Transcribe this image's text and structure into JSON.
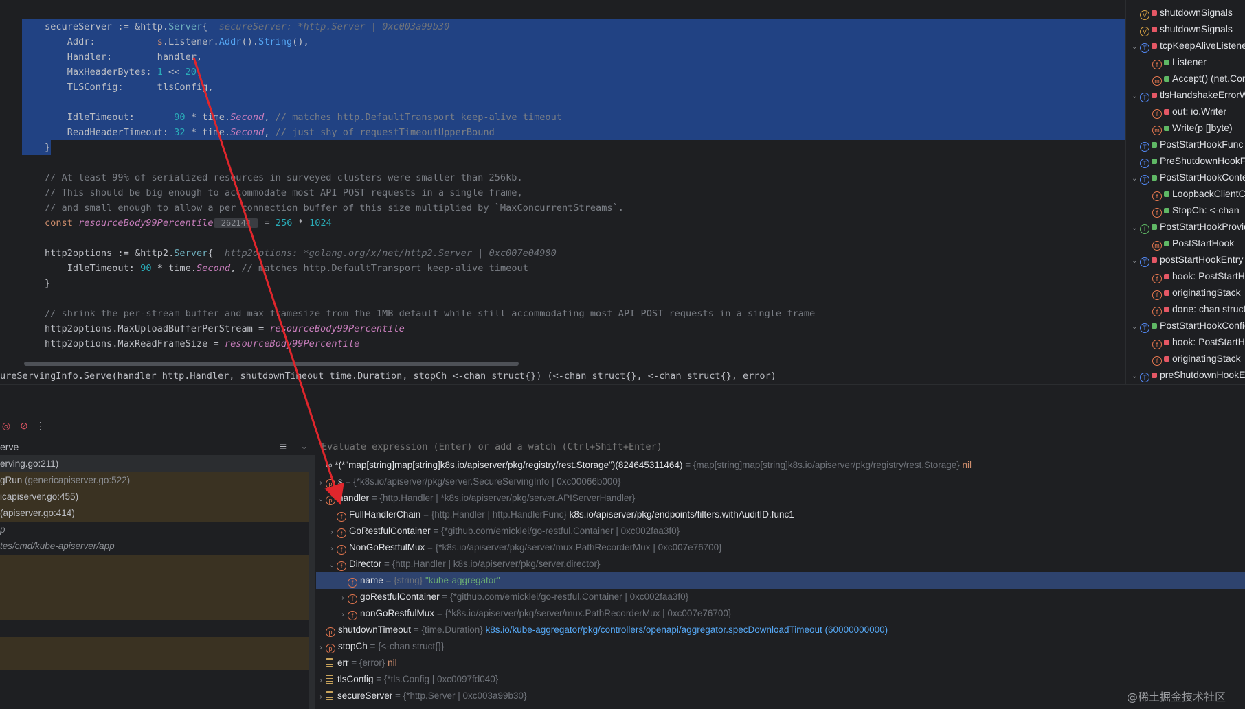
{
  "editor": {
    "lines": [
      {
        "segments": [
          {
            "t": "secureServer := &",
            "c": ""
          },
          {
            "t": "http",
            "c": ""
          },
          {
            "t": ".",
            "c": ""
          },
          {
            "t": "Server",
            "c": "typ"
          },
          {
            "t": "{  ",
            "c": ""
          },
          {
            "t": "secureServer: *http.Server | 0xc003a99b30",
            "c": "hint"
          }
        ]
      },
      {
        "segments": [
          {
            "t": "    Addr:           ",
            "c": ""
          },
          {
            "t": "s",
            "c": "kw"
          },
          {
            "t": ".Listener.",
            "c": ""
          },
          {
            "t": "Addr",
            "c": "fn"
          },
          {
            "t": "().",
            "c": ""
          },
          {
            "t": "String",
            "c": "fn"
          },
          {
            "t": "(),",
            "c": ""
          }
        ]
      },
      {
        "segments": [
          {
            "t": "    Handler:        handler,",
            "c": ""
          }
        ]
      },
      {
        "segments": [
          {
            "t": "    MaxHeaderBytes: ",
            "c": ""
          },
          {
            "t": "1",
            "c": "num"
          },
          {
            "t": " << ",
            "c": ""
          },
          {
            "t": "20",
            "c": "num"
          },
          {
            "t": ",",
            "c": ""
          }
        ]
      },
      {
        "segments": [
          {
            "t": "    TLSConfig:      tlsConfig,",
            "c": ""
          }
        ]
      },
      {
        "segments": [
          {
            "t": "",
            "c": ""
          }
        ]
      },
      {
        "segments": [
          {
            "t": "    IdleTimeout:       ",
            "c": ""
          },
          {
            "t": "90",
            "c": "num"
          },
          {
            "t": " * time.",
            "c": ""
          },
          {
            "t": "Second",
            "c": "it"
          },
          {
            "t": ", ",
            "c": ""
          },
          {
            "t": "// matches http.DefaultTransport keep-alive timeout",
            "c": "cmt"
          }
        ]
      },
      {
        "segments": [
          {
            "t": "    ReadHeaderTimeout: ",
            "c": ""
          },
          {
            "t": "32",
            "c": "num"
          },
          {
            "t": " * time.",
            "c": ""
          },
          {
            "t": "Second",
            "c": "it"
          },
          {
            "t": ", ",
            "c": ""
          },
          {
            "t": "// just shy of requestTimeoutUpperBound",
            "c": "cmt"
          }
        ]
      },
      {
        "segments": [
          {
            "t": "}",
            "c": ""
          }
        ]
      },
      {
        "segments": [
          {
            "t": "",
            "c": ""
          }
        ]
      },
      {
        "segments": [
          {
            "t": "// At least 99% of serialized resources in surveyed clusters were smaller than 256kb.",
            "c": "cmt"
          }
        ]
      },
      {
        "segments": [
          {
            "t": "// This should be big enough to accommodate most API POST requests in a single frame,",
            "c": "cmt"
          }
        ]
      },
      {
        "segments": [
          {
            "t": "// and small enough to allow a per connection buffer of this size multiplied by `MaxConcurrentStreams`.",
            "c": "cmt"
          }
        ]
      },
      {
        "segments": [
          {
            "t": "const ",
            "c": "kw"
          },
          {
            "t": "resourceBody99Percentile",
            "c": "it"
          },
          {
            "t": " 262144 ",
            "c": "inlay"
          },
          {
            "t": " = ",
            "c": ""
          },
          {
            "t": "256",
            "c": "num"
          },
          {
            "t": " * ",
            "c": ""
          },
          {
            "t": "1024",
            "c": "num"
          }
        ]
      },
      {
        "segments": [
          {
            "t": "",
            "c": ""
          }
        ]
      },
      {
        "segments": [
          {
            "t": "http2options := &",
            "c": ""
          },
          {
            "t": "http2",
            "c": ""
          },
          {
            "t": ".",
            "c": ""
          },
          {
            "t": "Server",
            "c": "typ"
          },
          {
            "t": "{  ",
            "c": ""
          },
          {
            "t": "http2options: *golang.org/x/net/http2.Server | 0xc007e04980",
            "c": "hint"
          }
        ]
      },
      {
        "segments": [
          {
            "t": "    IdleTimeout: ",
            "c": ""
          },
          {
            "t": "90",
            "c": "num"
          },
          {
            "t": " * time.",
            "c": ""
          },
          {
            "t": "Second",
            "c": "it"
          },
          {
            "t": ", ",
            "c": ""
          },
          {
            "t": "// matches http.DefaultTransport keep-alive timeout",
            "c": "cmt"
          }
        ]
      },
      {
        "segments": [
          {
            "t": "}",
            "c": ""
          }
        ]
      },
      {
        "segments": [
          {
            "t": "",
            "c": ""
          }
        ]
      },
      {
        "segments": [
          {
            "t": "// shrink the per-stream buffer and max framesize from the 1MB default while still accommodating most API POST requests in a single frame",
            "c": "cmt"
          }
        ]
      },
      {
        "segments": [
          {
            "t": "http2options.MaxUploadBufferPerStream = ",
            "c": ""
          },
          {
            "t": "resourceBody99Percentile",
            "c": "it"
          }
        ]
      },
      {
        "segments": [
          {
            "t": "http2options.MaxReadFrameSize = ",
            "c": ""
          },
          {
            "t": "resourceBody99Percentile",
            "c": "it"
          }
        ]
      }
    ]
  },
  "structure": {
    "items": [
      {
        "indent": 0,
        "chev": "",
        "badge": "V",
        "bclass": "b-v",
        "lock": "r",
        "label": "shutdownSignals"
      },
      {
        "indent": 0,
        "chev": "",
        "badge": "V",
        "bclass": "b-v",
        "lock": "r",
        "label": "shutdownSignals"
      },
      {
        "indent": 0,
        "chev": "⌄",
        "badge": "T",
        "bclass": "b-t",
        "lock": "r",
        "label": "tcpKeepAliveListener"
      },
      {
        "indent": 1,
        "chev": "",
        "badge": "f",
        "bclass": "b-f",
        "lock": "g",
        "label": "Listener"
      },
      {
        "indent": 1,
        "chev": "",
        "badge": "m",
        "bclass": "b-m",
        "lock": "g",
        "label": "Accept() (net.Conn"
      },
      {
        "indent": 0,
        "chev": "⌄",
        "badge": "T",
        "bclass": "b-t",
        "lock": "r",
        "label": "tlsHandshakeErrorWriter"
      },
      {
        "indent": 1,
        "chev": "",
        "badge": "f",
        "bclass": "b-f",
        "lock": "r",
        "label": "out: io.Writer"
      },
      {
        "indent": 1,
        "chev": "",
        "badge": "m",
        "bclass": "b-m",
        "lock": "g",
        "label": "Write(p []byte)"
      },
      {
        "indent": 0,
        "chev": "",
        "badge": "T",
        "bclass": "b-t",
        "lock": "g",
        "label": "PostStartHookFunc"
      },
      {
        "indent": 0,
        "chev": "",
        "badge": "T",
        "bclass": "b-t",
        "lock": "g",
        "label": "PreShutdownHookFunc"
      },
      {
        "indent": 0,
        "chev": "⌄",
        "badge": "T",
        "bclass": "b-t",
        "lock": "g",
        "label": "PostStartHookContext"
      },
      {
        "indent": 1,
        "chev": "",
        "badge": "f",
        "bclass": "b-f",
        "lock": "g",
        "label": "LoopbackClientConfig"
      },
      {
        "indent": 1,
        "chev": "",
        "badge": "f",
        "bclass": "b-f",
        "lock": "g",
        "label": "StopCh: <-chan"
      },
      {
        "indent": 0,
        "chev": "⌄",
        "badge": "I",
        "bclass": "b-i",
        "lock": "g",
        "label": "PostStartHookProvider"
      },
      {
        "indent": 1,
        "chev": "",
        "badge": "m",
        "bclass": "b-m",
        "lock": "g",
        "label": "PostStartHook"
      },
      {
        "indent": 0,
        "chev": "⌄",
        "badge": "T",
        "bclass": "b-t",
        "lock": "r",
        "label": "postStartHookEntry"
      },
      {
        "indent": 1,
        "chev": "",
        "badge": "f",
        "bclass": "b-f",
        "lock": "r",
        "label": "hook: PostStartHookFunc"
      },
      {
        "indent": 1,
        "chev": "",
        "badge": "f",
        "bclass": "b-f",
        "lock": "r",
        "label": "originatingStack"
      },
      {
        "indent": 1,
        "chev": "",
        "badge": "f",
        "bclass": "b-f",
        "lock": "r",
        "label": "done: chan struct"
      },
      {
        "indent": 0,
        "chev": "⌄",
        "badge": "T",
        "bclass": "b-t",
        "lock": "g",
        "label": "PostStartHookConfigEntry"
      },
      {
        "indent": 1,
        "chev": "",
        "badge": "f",
        "bclass": "b-f",
        "lock": "r",
        "label": "hook: PostStartHook"
      },
      {
        "indent": 1,
        "chev": "",
        "badge": "f",
        "bclass": "b-f",
        "lock": "r",
        "label": "originatingStack"
      },
      {
        "indent": 0,
        "chev": "⌄",
        "badge": "T",
        "bclass": "b-t",
        "lock": "r",
        "label": "preShutdownHookEntry"
      }
    ]
  },
  "breadcrumb": {
    "text": "ureServingInfo.Serve(handler http.Handler, shutdownTimeout time.Duration, stopCh <-chan struct{}) (<-chan struct{}, <-chan struct{}, error)"
  },
  "toolbar": {
    "mute_icon": "breakpoint-icon",
    "more_icon": "more-icon"
  },
  "frames": {
    "thread": "erve",
    "rows": [
      {
        "main": "erving.go:211)",
        "file": "",
        "style": "selected"
      },
      {
        "main": "gRun",
        "file": " (genericapiserver.go:522)",
        "style": "lib"
      },
      {
        "main": "icapiserver.go:455)",
        "file": "",
        "style": "lib"
      },
      {
        "main": " (apiserver.go:414)",
        "file": "",
        "style": "lib"
      },
      {
        "main": "p",
        "file": "",
        "style": "plain"
      },
      {
        "main": "tes/cmd/kube-apiserver/app",
        "file": "",
        "style": "plain"
      },
      {
        "main": "",
        "file": "",
        "style": "lib"
      },
      {
        "main": "",
        "file": "",
        "style": "lib"
      },
      {
        "main": "",
        "file": "",
        "style": "lib"
      },
      {
        "main": "",
        "file": "",
        "style": "lib"
      },
      {
        "main": "",
        "file": "",
        "style": "plain"
      },
      {
        "main": "",
        "file": "",
        "style": "lib"
      },
      {
        "main": "",
        "file": "",
        "style": "lib"
      },
      {
        "main": "",
        "file": "",
        "style": "plain"
      },
      {
        "main": "",
        "file": "",
        "style": "plain"
      }
    ]
  },
  "variables": {
    "placeholder": "Evaluate expression (Enter) or add a watch (Ctrl+Shift+Enter)",
    "rows": [
      {
        "indent": 0,
        "chev": "",
        "icon": "watch",
        "name": "*(*\"map[string]map[string]k8s.io/apiserver/pkg/registry/rest.Storage\")(824645311464)",
        "type": " = {map[string]map[string]k8s.io/apiserver/pkg/registry/rest.Storage} ",
        "val": "nil",
        "vclass": "vnil"
      },
      {
        "indent": 0,
        "chev": "›",
        "icon": "p",
        "name": "s",
        "type": " = {*k8s.io/apiserver/pkg/server.SecureServingInfo | 0xc00066b000}",
        "val": "",
        "vclass": ""
      },
      {
        "indent": 0,
        "chev": "⌄",
        "icon": "p",
        "name": "handler",
        "type": " = {http.Handler | *k8s.io/apiserver/pkg/server.APIServerHandler}",
        "val": "",
        "vclass": ""
      },
      {
        "indent": 1,
        "chev": "",
        "icon": "f",
        "name": "FullHandlerChain",
        "type": " = {http.Handler | http.HandlerFunc} ",
        "val": "k8s.io/apiserver/pkg/endpoints/filters.withAuditID.func1",
        "vclass": "vval"
      },
      {
        "indent": 1,
        "chev": "›",
        "icon": "f",
        "name": "GoRestfulContainer",
        "type": " = {*github.com/emicklei/go-restful.Container | 0xc002faa3f0}",
        "val": "",
        "vclass": ""
      },
      {
        "indent": 1,
        "chev": "›",
        "icon": "f",
        "name": "NonGoRestfulMux",
        "type": " = {*k8s.io/apiserver/pkg/server/mux.PathRecorderMux | 0xc007e76700}",
        "val": "",
        "vclass": ""
      },
      {
        "indent": 1,
        "chev": "⌄",
        "icon": "f",
        "name": "Director",
        "type": " = {http.Handler | k8s.io/apiserver/pkg/server.director}",
        "val": "",
        "vclass": ""
      },
      {
        "indent": 2,
        "chev": "",
        "icon": "f",
        "name": "name",
        "type": " = {string} ",
        "val": "\"kube-aggregator\"",
        "vclass": "vstr",
        "selected": true
      },
      {
        "indent": 2,
        "chev": "›",
        "icon": "f",
        "name": "goRestfulContainer",
        "type": " = {*github.com/emicklei/go-restful.Container | 0xc002faa3f0}",
        "val": "",
        "vclass": ""
      },
      {
        "indent": 2,
        "chev": "›",
        "icon": "f",
        "name": "nonGoRestfulMux",
        "type": " = {*k8s.io/apiserver/pkg/server/mux.PathRecorderMux | 0xc007e76700}",
        "val": "",
        "vclass": ""
      },
      {
        "indent": 0,
        "chev": "",
        "icon": "p",
        "name": "shutdownTimeout",
        "type": " = {time.Duration} ",
        "val": "k8s.io/kube-aggregator/pkg/controllers/openapi/aggregator.specDownloadTimeout (60000000000)",
        "vclass": "vlink"
      },
      {
        "indent": 0,
        "chev": "›",
        "icon": "p",
        "name": "stopCh",
        "type": " = {<-chan struct{}}",
        "val": "",
        "vclass": ""
      },
      {
        "indent": 0,
        "chev": "",
        "icon": "db",
        "name": "err",
        "type": " = {error} ",
        "val": "nil",
        "vclass": "vnil"
      },
      {
        "indent": 0,
        "chev": "›",
        "icon": "db",
        "name": "tlsConfig",
        "type": " = {*tls.Config | 0xc0097fd040}",
        "val": "",
        "vclass": ""
      },
      {
        "indent": 0,
        "chev": "›",
        "icon": "db",
        "name": "secureServer",
        "type": " = {*http.Server | 0xc003a99b30}",
        "val": "",
        "vclass": ""
      }
    ]
  },
  "watermark": "@稀土掘金技术社区",
  "colors": {
    "selection": "#214283",
    "lib_frame_bg": "#3a3222",
    "arrow": "#e0262c"
  }
}
